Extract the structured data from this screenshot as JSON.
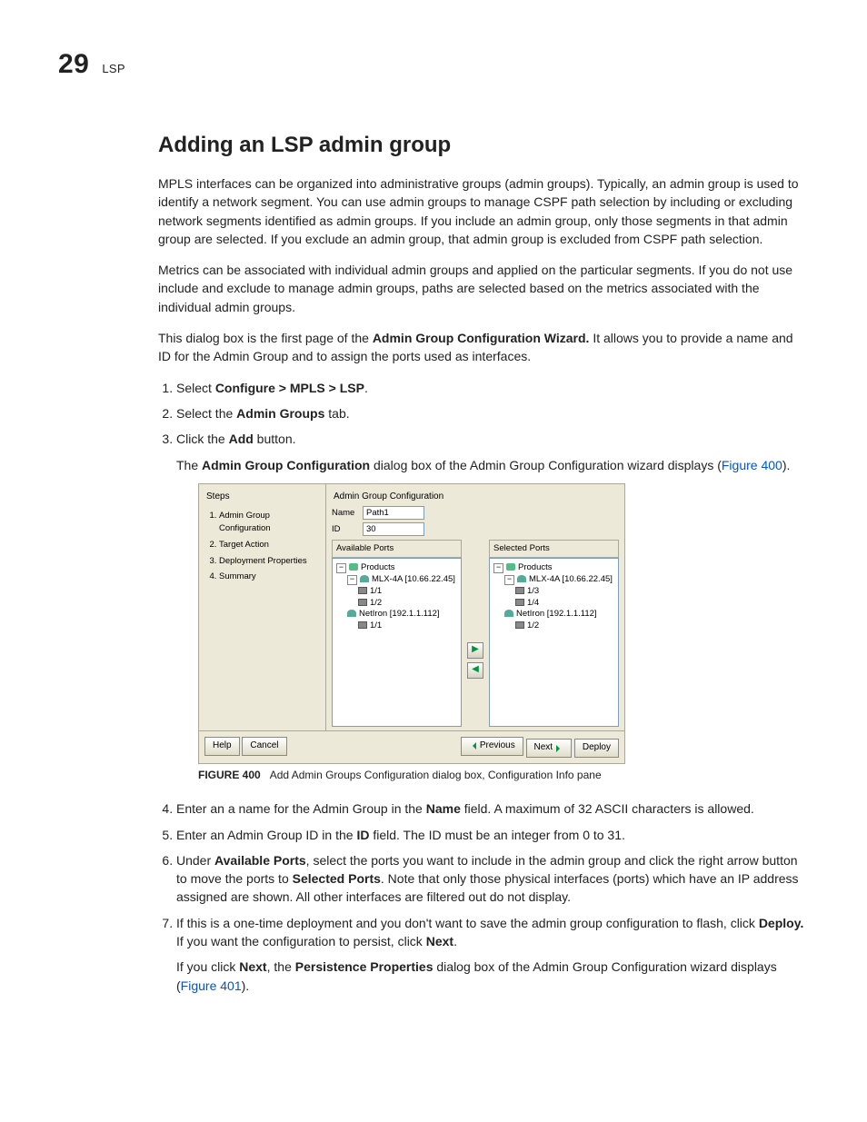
{
  "header": {
    "chapter_number": "29",
    "section_label": "LSP"
  },
  "heading": "Adding an LSP admin group",
  "para1": "MPLS interfaces can be organized into administrative groups (admin groups). Typically, an admin group is used to identify a network segment. You can use admin groups to manage CSPF path selection by including or excluding network segments identified as admin groups. If you include an admin group, only those segments in that admin group are selected. If you exclude an admin group, that admin group is excluded from CSPF path selection.",
  "para2": "Metrics can be associated with individual admin groups and applied on the particular segments. If you do not use include and exclude to manage admin groups, paths are selected based on the metrics associated with the individual admin groups.",
  "para3_a": "This dialog box is the first page of the ",
  "para3_b": "Admin Group Configuration Wizard.",
  "para3_c": " It allows you to provide a name and ID for the Admin Group and to assign the ports used as interfaces.",
  "step1_a": "Select ",
  "step1_b": "Configure > MPLS > LSP",
  "step1_c": ".",
  "step2_a": "Select the ",
  "step2_b": "Admin Groups",
  "step2_c": " tab.",
  "step3_a": "Click the ",
  "step3_b": "Add",
  "step3_c": " button.",
  "step3p_a": "The ",
  "step3p_b": "Admin Group Configuration",
  "step3p_c": " dialog box of the Admin Group Configuration wizard displays (",
  "step3p_link": "Figure 400",
  "step3p_d": ").",
  "dialog": {
    "steps_title": "Steps",
    "wizard_steps": {
      "s1": "Admin Group Configuration",
      "s2": "Target Action",
      "s3": "Deployment Properties",
      "s4": "Summary"
    },
    "cfg_title": "Admin Group Configuration",
    "name_label": "Name",
    "name_value": "Path1",
    "id_label": "ID",
    "id_value": "30",
    "avail_label": "Available Ports",
    "sel_label": "Selected Ports",
    "products": "Products",
    "devA": "MLX-4A [10.66.22.45]",
    "devB": "NetIron [192.1.1.112]",
    "p11": "1/1",
    "p12": "1/2",
    "p13": "1/3",
    "p14": "1/4",
    "help": "Help",
    "cancel": "Cancel",
    "prev": "Previous",
    "next": "Next",
    "deploy": "Deploy"
  },
  "figcap_no": "FIGURE 400",
  "figcap_txt": "Add Admin Groups Configuration dialog box, Configuration Info pane",
  "step4_a": "Enter an a name for the Admin Group in the ",
  "step4_b": "Name",
  "step4_c": " field. A maximum of 32 ASCII characters is allowed.",
  "step5_a": "Enter an Admin Group ID in the ",
  "step5_b": "ID",
  "step5_c": " field. The ID must be an integer from 0 to 31.",
  "step6_a": "Under ",
  "step6_b": "Available Ports",
  "step6_c": ", select the ports you want to include in the admin group and click the right arrow button to move the ports to ",
  "step6_d": "Selected Ports",
  "step6_e": ". Note that only those physical interfaces (ports) which have an IP address assigned are shown. All other interfaces are filtered out do not display.",
  "step7_a": "If this is a one-time deployment and you don't want to save the admin group configuration to flash, click ",
  "step7_b": "Deploy.",
  "step7_c": " If you want the configuration to persist, click ",
  "step7_d": "Next",
  "step7_e": ".",
  "step7p_a": "If you click ",
  "step7p_b": "Next",
  "step7p_c": ", the ",
  "step7p_d": "Persistence Properties",
  "step7p_e": " dialog box of the Admin Group Configuration wizard displays (",
  "step7p_link": "Figure 401",
  "step7p_f": ")."
}
